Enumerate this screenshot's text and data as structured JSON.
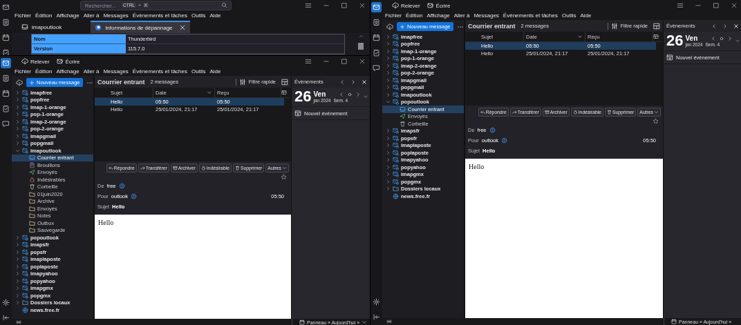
{
  "back_window": {
    "spaces": [
      {
        "kind": "mail",
        "selected": false
      },
      {
        "kind": "contacts",
        "selected": false
      },
      {
        "kind": "calendar",
        "selected": false
      },
      {
        "kind": "tasks",
        "selected": false
      }
    ],
    "search": {
      "placeholder": "Rechercher...",
      "shortcut": [
        {
          "kind": "key",
          "text": "CTRL"
        },
        {
          "kind": "plus",
          "text": "+"
        },
        {
          "kind": "key",
          "text": "K"
        }
      ]
    },
    "menu": [
      "Fichier",
      "Édition",
      "Affichage",
      "Aller à",
      "Messages",
      "Évènements et tâches",
      "Outils",
      "Aide"
    ],
    "tabs": [
      {
        "kind": "folder",
        "label": "imapoutlook",
        "selected": false
      },
      {
        "kind": "app",
        "label": "Informations de dépannage",
        "selected": true
      }
    ],
    "table": [
      {
        "name": "Nom",
        "value": "Thunderbird"
      },
      {
        "name": "Version",
        "value": "115.7.0"
      }
    ]
  },
  "windows": [
    {
      "spaces": [
        {
          "kind": "mail",
          "selected": true
        },
        {
          "kind": "contacts",
          "selected": false
        },
        {
          "kind": "calendar",
          "selected": false
        },
        {
          "kind": "tasks",
          "selected": false
        },
        {
          "kind": "chat",
          "selected": false
        }
      ],
      "toolbar": [
        {
          "kind": "get",
          "label": "Relever"
        },
        {
          "kind": "write",
          "label": "Écrire"
        }
      ],
      "menu": [
        "Fichier",
        "Édition",
        "Affichage",
        "Aller à",
        "Messages",
        "Évènements et tâches",
        "Outils",
        "Aide"
      ],
      "new_message": "Nouveau message",
      "folders": [
        {
          "kind": "account",
          "label": "imapfree",
          "expanded": false,
          "selected": false
        },
        {
          "kind": "account",
          "label": "popfree",
          "expanded": false,
          "selected": false
        },
        {
          "kind": "account",
          "label": "imap-1-orange",
          "expanded": false,
          "selected": false
        },
        {
          "kind": "account",
          "label": "pop-1-orange",
          "expanded": false,
          "selected": false
        },
        {
          "kind": "account",
          "label": "imap-2-orange",
          "expanded": false,
          "selected": false
        },
        {
          "kind": "account",
          "label": "pop-2-orange",
          "expanded": false,
          "selected": false
        },
        {
          "kind": "account",
          "label": "imapgmail",
          "expanded": false,
          "selected": false
        },
        {
          "kind": "account",
          "label": "popgmail",
          "expanded": false,
          "selected": false
        },
        {
          "kind": "account",
          "label": "imapoutlook",
          "expanded": true,
          "selected": false,
          "children": [
            {
              "kind": "inbox",
              "label": "Courrier entrant",
              "selected": true
            },
            {
              "kind": "drafts",
              "label": "Brouillons",
              "selected": false
            },
            {
              "kind": "sent",
              "label": "Envoyés",
              "selected": false
            },
            {
              "kind": "junk",
              "label": "Indésirables",
              "selected": false
            },
            {
              "kind": "trash",
              "label": "Corbeille",
              "selected": false
            },
            {
              "kind": "folder",
              "label": "01juin2020",
              "selected": false
            },
            {
              "kind": "folder",
              "label": "Archive",
              "selected": false
            },
            {
              "kind": "folder",
              "label": "Envoyés",
              "selected": false
            },
            {
              "kind": "folder",
              "label": "Notes",
              "selected": false
            },
            {
              "kind": "folder",
              "label": "Outbox",
              "selected": false
            },
            {
              "kind": "folder",
              "label": "Sauvegarde",
              "selected": false
            }
          ]
        },
        {
          "kind": "account",
          "label": "popoutlook",
          "expanded": false,
          "selected": false
        },
        {
          "kind": "account",
          "label": "imapsfr",
          "expanded": false,
          "selected": false
        },
        {
          "kind": "account",
          "label": "popsfr",
          "expanded": false,
          "selected": false
        },
        {
          "kind": "account",
          "label": "imaplaposte",
          "expanded": false,
          "selected": false
        },
        {
          "kind": "account",
          "label": "poplaposte",
          "expanded": false,
          "selected": false
        },
        {
          "kind": "account",
          "label": "imapyahoo",
          "expanded": false,
          "selected": false
        },
        {
          "kind": "account",
          "label": "popyahoo",
          "expanded": false,
          "selected": false
        },
        {
          "kind": "account",
          "label": "imapgmx",
          "expanded": false,
          "selected": false
        },
        {
          "kind": "account",
          "label": "popgmx",
          "expanded": false,
          "selected": false
        },
        {
          "kind": "local",
          "label": "Dossiers locaux",
          "expanded": false,
          "selected": false
        },
        {
          "kind": "news",
          "label": "news.free.fr",
          "selected": false
        }
      ],
      "folder_title": "Courrier entrant",
      "message_count": "2 messages",
      "quick_filter": "Filtre rapide",
      "columns": [
        "Sujet",
        "Date",
        "Reçu"
      ],
      "messages": [
        {
          "subject": "Hello",
          "date": "05:50",
          "received": "05:50",
          "selected": true
        },
        {
          "subject": "Hello",
          "date": "25/01/2024, 21:17",
          "received": "25/01/2024, 21:17",
          "selected": false
        }
      ],
      "actions": [
        {
          "kind": "reply",
          "label": "Répondre"
        },
        {
          "kind": "forward",
          "label": "Transférer"
        },
        {
          "kind": "archive",
          "label": "Archiver"
        },
        {
          "kind": "junk",
          "label": "Indésirable"
        },
        {
          "kind": "trash",
          "label": "Supprimer"
        },
        {
          "kind": "more",
          "label": "Autres"
        }
      ],
      "headers": {
        "from_label": "De",
        "from": "free",
        "to_label": "Pour",
        "to": "outlook",
        "time": "05:50",
        "subject_label": "Sujet",
        "subject": "Hello"
      },
      "body": "Hello",
      "today": {
        "title": "Évènements",
        "day": "26",
        "weekday": "Ven",
        "month": "jan 2024",
        "week": "Sem. 4",
        "new_event": "Nouvel évènement",
        "footer": "Panneau « Aujourd'hui »",
        "footer_caret": true
      }
    },
    {
      "spaces": [
        {
          "kind": "mail",
          "selected": true
        },
        {
          "kind": "contacts",
          "selected": false
        },
        {
          "kind": "calendar",
          "selected": false
        },
        {
          "kind": "tasks",
          "selected": false
        },
        {
          "kind": "chat",
          "selected": false
        }
      ],
      "toolbar": [
        {
          "kind": "get",
          "label": "Relever"
        },
        {
          "kind": "write",
          "label": "Écrire"
        }
      ],
      "menu": [
        "Fichier",
        "Édition",
        "Affichage",
        "Aller à",
        "Messages",
        "Évènements et tâches",
        "Outils",
        "Aide"
      ],
      "new_message": "Nouveau message",
      "folders": [
        {
          "kind": "account",
          "label": "imapfree",
          "expanded": false,
          "selected": false
        },
        {
          "kind": "account",
          "label": "popfree",
          "expanded": false,
          "selected": false
        },
        {
          "kind": "account",
          "label": "imap-1-orange",
          "expanded": false,
          "selected": false
        },
        {
          "kind": "account",
          "label": "pop-1-orange",
          "expanded": false,
          "selected": false
        },
        {
          "kind": "account",
          "label": "imap-2-orange",
          "expanded": false,
          "selected": false
        },
        {
          "kind": "account",
          "label": "pop-2-orange",
          "expanded": false,
          "selected": false
        },
        {
          "kind": "account",
          "label": "imapgmail",
          "expanded": false,
          "selected": false
        },
        {
          "kind": "account",
          "label": "popgmail",
          "expanded": false,
          "selected": false
        },
        {
          "kind": "account",
          "label": "imapoutlook",
          "expanded": false,
          "selected": false
        },
        {
          "kind": "account",
          "label": "popoutlook",
          "expanded": true,
          "selected": false,
          "children": [
            {
              "kind": "inbox",
              "label": "Courrier entrant",
              "selected": true
            },
            {
              "kind": "sent",
              "label": "Envoyés",
              "selected": false
            },
            {
              "kind": "trash",
              "label": "Corbeille",
              "selected": false
            }
          ]
        },
        {
          "kind": "account",
          "label": "imapsfr",
          "expanded": false,
          "selected": false
        },
        {
          "kind": "account",
          "label": "popsfr",
          "expanded": false,
          "selected": false
        },
        {
          "kind": "account",
          "label": "imaplaposte",
          "expanded": false,
          "selected": false
        },
        {
          "kind": "account",
          "label": "poplaposte",
          "expanded": false,
          "selected": false
        },
        {
          "kind": "account",
          "label": "imapyahoo",
          "expanded": false,
          "selected": false
        },
        {
          "kind": "account",
          "label": "popyahoo",
          "expanded": false,
          "selected": false
        },
        {
          "kind": "account",
          "label": "imapgmx",
          "expanded": false,
          "selected": false
        },
        {
          "kind": "account",
          "label": "popgmx",
          "expanded": false,
          "selected": false
        },
        {
          "kind": "local",
          "label": "Dossiers locaux",
          "expanded": false,
          "selected": false
        },
        {
          "kind": "news",
          "label": "news.free.fr",
          "selected": false
        }
      ],
      "folder_title": "Courrier entrant",
      "message_count": "2 messages",
      "quick_filter": "Filtre rapide",
      "columns": [
        "Sujet",
        "Date",
        "Reçu"
      ],
      "messages": [
        {
          "subject": "Hello",
          "date": "05:50",
          "received": "05:50",
          "selected": true
        },
        {
          "subject": "Hello",
          "date": "25/01/2024, 21:17",
          "received": "25/01/2024, 21:17",
          "selected": false
        }
      ],
      "actions": [
        {
          "kind": "reply",
          "label": "Répondre"
        },
        {
          "kind": "forward",
          "label": "Transférer"
        },
        {
          "kind": "archive",
          "label": "Archiver"
        },
        {
          "kind": "junk",
          "label": "Indésirable"
        },
        {
          "kind": "trash",
          "label": "Supprimer"
        },
        {
          "kind": "more",
          "label": "Autres"
        }
      ],
      "headers": {
        "from_label": "De",
        "from": "free",
        "to_label": "Pour",
        "to": "outlook",
        "time": "05:50",
        "subject_label": "Sujet",
        "subject": "Hello"
      },
      "body": "Hello",
      "today": {
        "title": "Évènements",
        "day": "26",
        "weekday": "Ven",
        "month": "jan 2024",
        "week": "Sem. 4",
        "new_event": "Nouvel évènement",
        "footer": "Panneau « Aujourd'hui »",
        "footer_caret": false
      }
    }
  ]
}
